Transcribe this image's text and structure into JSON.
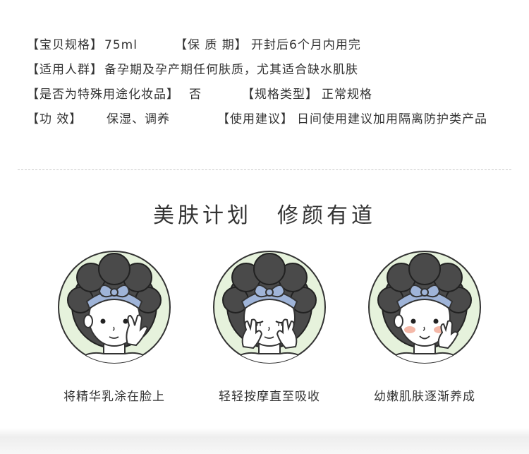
{
  "specs": [
    {
      "label": "【宝贝规格】",
      "value": "75ml",
      "label2": "【保 质 期】",
      "value2": "开封后6个月内用完"
    },
    {
      "label": "【适用人群】",
      "value": "备孕期及孕产期任何肤质，尤其适合缺水肌肤"
    },
    {
      "label": "【是否为特殊用途化妆品】",
      "value": "否",
      "label2": "【规格类型】",
      "value2": "正常规格"
    },
    {
      "label": "【功        效】",
      "value": "保湿、调养",
      "label2": "【使用建议】",
      "value2": "日间使用建议加用隔离防护类产品"
    }
  ],
  "headline": {
    "part1": "美肤计划",
    "part2": "修颜有道"
  },
  "steps": [
    {
      "caption": "将精华乳涂在脸上"
    },
    {
      "caption": "轻轻按摩直至吸收"
    },
    {
      "caption": "幼嫩肌肤逐渐养成"
    }
  ],
  "colors": {
    "circle_fill": "#e6f2dc",
    "hair": "#4a4a4a",
    "headband": "#9fb4d8",
    "text": "#333333"
  },
  "icons": [
    "girl-applying-serum-icon",
    "girl-massaging-face-icon",
    "girl-smiling-icon"
  ]
}
